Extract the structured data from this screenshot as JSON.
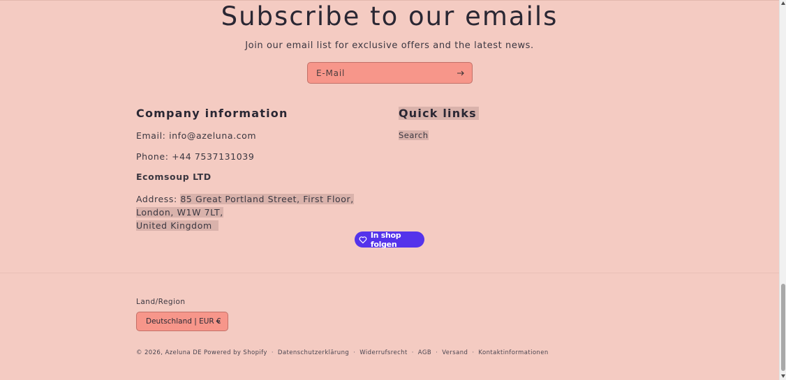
{
  "newsletter": {
    "title": "Subscribe to our emails",
    "subtitle": "Join our email list for exclusive offers and the latest news.",
    "email_placeholder": "E-Mail"
  },
  "company": {
    "title": "Company information",
    "email": "Email: info@azeluna.com",
    "phone": "Phone: +44 7537131039",
    "name": "Ecomsoup LTD",
    "address_label": "Address: ",
    "address_line1": "85 Great Portland Street, First Floor, London, W1W 7LT,",
    "address_line2": "United Kingdom"
  },
  "quick_links": {
    "title": "Quick links",
    "items": [
      "Search"
    ]
  },
  "follow_button": {
    "label": "In shop folgen"
  },
  "region": {
    "label": "Land/Region",
    "selected": "Deutschland | EUR €"
  },
  "footer": {
    "copyright": "© 2026,",
    "store_name": "Azeluna DE",
    "powered": "Powered by Shopify",
    "links": [
      "Datenschutzerklärung",
      "Widerrufsrecht",
      "AGB",
      "Versand",
      "Kontaktinformationen"
    ]
  },
  "colors": {
    "background": "#f4cbc2",
    "field": "#f7968a",
    "follow_button": "#5433eb"
  },
  "icons": {
    "submit": "arrow-right-icon",
    "follow": "heart-icon",
    "dropdown": "chevron-down-icon"
  }
}
